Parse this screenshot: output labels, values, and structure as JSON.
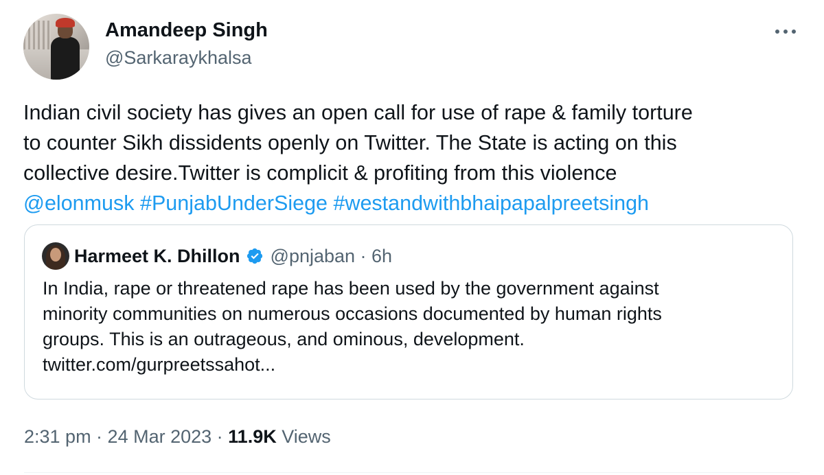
{
  "author": {
    "name": "Amandeep Singh",
    "handle": "@Sarkaraykhalsa",
    "avatar_icon": "user-avatar"
  },
  "more_icon": "ellipsis-horizontal-icon",
  "tweet": {
    "text_lines": [
      "Indian civil society has gives an open call for use of rape & family torture",
      "to counter Sikh dissidents openly on Twitter. The State is acting on this",
      "collective desire.Twitter is complicit & profiting from this violence"
    ],
    "mention": "@elonmusk",
    "hashtags": [
      "#PunjabUnderSiege",
      "#westandwithbhaipapalpreetsingh"
    ]
  },
  "quoted_tweet": {
    "author_name": "Harmeet K. Dhillon",
    "verified_icon": "verified-badge-icon",
    "meta": "@pnjaban · 6h",
    "text_lines": [
      "In India, rape or threatened rape has been used by the government against",
      "minority communities on numerous occasions documented by human rights",
      "groups. This is an outrageous, and ominous, development.",
      "twitter.com/gurpreetssahot..."
    ]
  },
  "footer": {
    "timestamp": "2:31 pm · 24 Mar 2023 · ",
    "views_count": "11.9K",
    "views_label": " Views"
  },
  "colors": {
    "text": "#0f1419",
    "secondary": "#536471",
    "link": "#1d9bf0",
    "border": "#cfd9de"
  }
}
